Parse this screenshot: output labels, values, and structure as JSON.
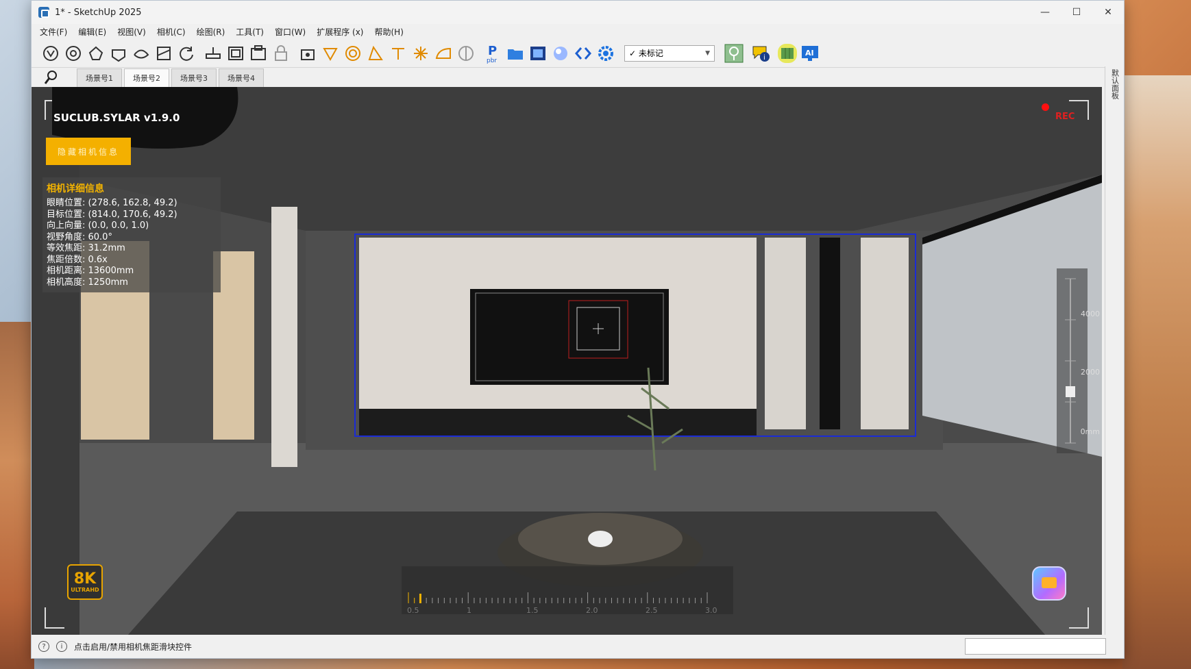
{
  "window": {
    "title": "1* - SketchUp 2025",
    "controls": {
      "minimize": "—",
      "maximize": "☐",
      "close": "✕"
    }
  },
  "menu": [
    "文件(F)",
    "编辑(E)",
    "视图(V)",
    "相机(C)",
    "绘图(R)",
    "工具(T)",
    "窗口(W)",
    "扩展程序 (x)",
    "帮助(H)"
  ],
  "toolbar": {
    "tag_select_value": "未标记",
    "tag_check": "✓",
    "icons": [
      "orbit-tool-icon",
      "pan-tool-icon",
      "zoom-tool-icon",
      "zoom-window-icon",
      "zoom-extents-icon",
      "previous-view-icon",
      "rotate-icon",
      "section-plane-icon",
      "display-section-icon",
      "section-fill-icon",
      "lock-icon",
      "scene-settings-icon",
      "tape-measure-icon",
      "protractor-icon",
      "axes-icon",
      "dimension-icon",
      "text-icon",
      "sun-icon",
      "hemisphere-icon",
      "sphere-icon",
      "pbr-icon",
      "folder-icon",
      "render-window-icon",
      "render-sphere-icon",
      "code-icon",
      "gear-icon"
    ],
    "right_icons": [
      "cloud-tree-icon",
      "info-icon",
      "map-icon",
      "ai-icon"
    ]
  },
  "tabs": [
    "场景号1",
    "场景号2",
    "场景号3",
    "场景号4"
  ],
  "active_tab": "场景号2",
  "right_panel": {
    "label": "默认面板"
  },
  "viewport": {
    "plugin_name": "SUCLUB.SYLAR v1.9.0",
    "hide_button": "隐藏相机信息",
    "info_title": "相机详细信息",
    "info": [
      "眼睛位置: (278.6, 162.8, 49.2)",
      "目标位置: (814.0, 170.6, 49.2)",
      "向上向量: (0.0, 0.0, 1.0)",
      "视野角度: 60.0°",
      "等效焦距: 31.2mm",
      "焦距倍数: 0.6x",
      "相机距离: 13600mm",
      "相机高度: 1250mm"
    ],
    "rec": "REC",
    "badge_top": "8K",
    "badge_bottom": "ULTRAHD",
    "zoom_labels": [
      "0.5",
      "1",
      "1.5",
      "2.0",
      "2.5",
      "3.0"
    ],
    "height_labels": [
      "4000",
      "2000",
      "0mm"
    ],
    "focal_multiplier": 0.6,
    "camera_height_mm": 1250
  },
  "statusbar": {
    "message": "点击启用/禁用相机焦距滑块控件",
    "icon_left": "?",
    "icon_info": "i"
  },
  "colors": {
    "accent_yellow": "#f4b000",
    "rec_red": "#e02020",
    "selection_blue": "#1b2bd6"
  }
}
